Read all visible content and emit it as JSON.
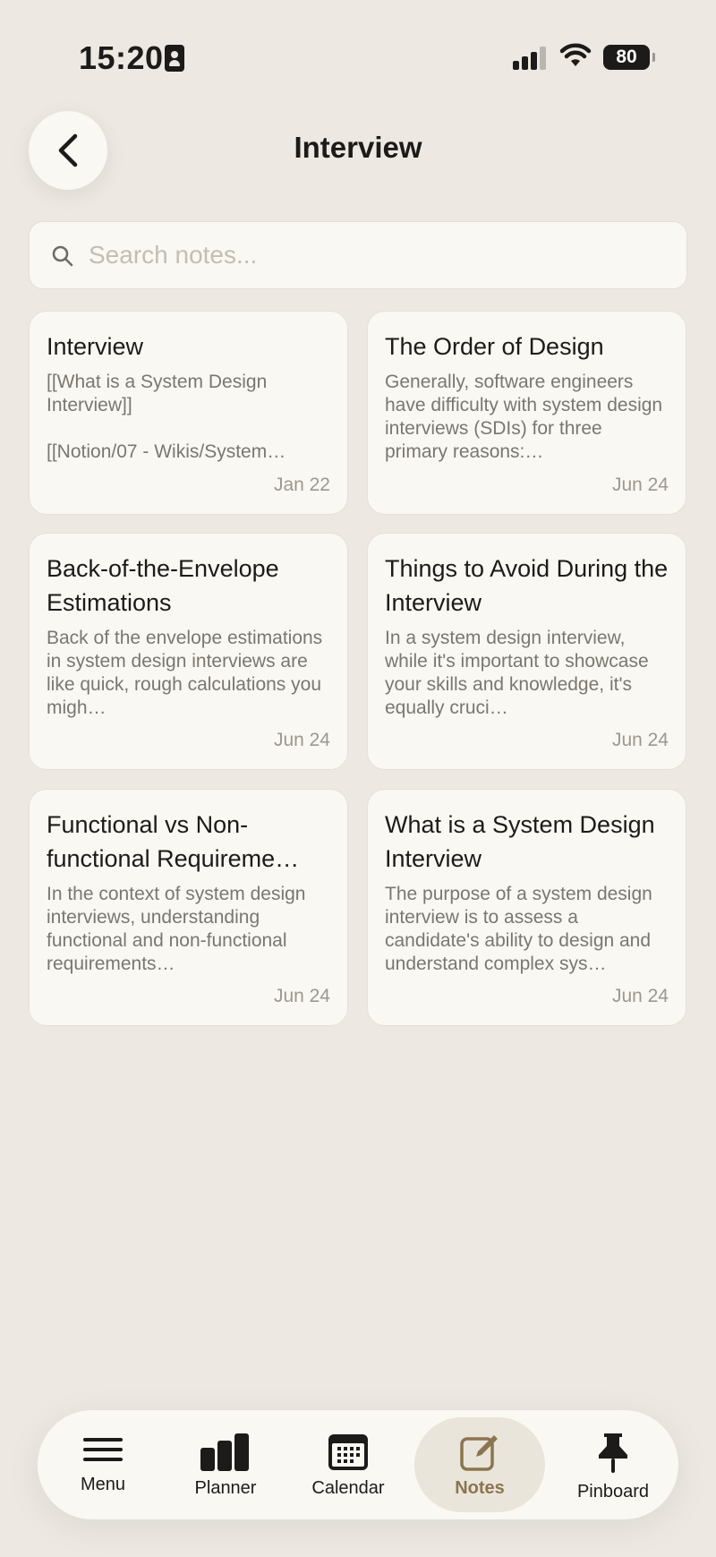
{
  "status_bar": {
    "time": "15:20",
    "battery": "80",
    "icons": [
      "contact-card-icon",
      "signal-icon",
      "wifi-icon",
      "battery-icon"
    ]
  },
  "header": {
    "title": "Interview",
    "back_icon": "chevron-left-icon"
  },
  "search": {
    "placeholder": "Search notes...",
    "value": ""
  },
  "notes": [
    {
      "title": "Interview",
      "snippet": "[[What is a System Design Interview]]\n\n[[Notion/07 - Wikis/System…",
      "date": "Jan 22"
    },
    {
      "title": "The Order of Design",
      "snippet": "Generally, software engineers have difficulty with system design interviews (SDIs) for three primary reasons:…",
      "date": "Jun 24"
    },
    {
      "title": "Back-of-the-Envelope Estimations",
      "snippet": "Back of the envelope estimations in system design interviews are like quick, rough calculations you migh…",
      "date": "Jun 24"
    },
    {
      "title": "Things to Avoid During the Interview",
      "snippet": "In a system design interview, while it's important to showcase your skills and knowledge, it's equally cruci…",
      "date": "Jun 24"
    },
    {
      "title": "Functional vs Non-functional Requireme…",
      "snippet": "In the context of system design interviews, understanding functional and non-functional requirements…",
      "date": "Jun 24"
    },
    {
      "title": "What is a System Design Interview",
      "snippet": "The purpose of a system design interview is to assess a candidate's ability to design and understand complex sys…",
      "date": "Jun 24"
    }
  ],
  "tabbar": {
    "active": "Notes",
    "active_color": "#8a7550",
    "items": [
      {
        "label": "Menu",
        "icon": "menu-icon"
      },
      {
        "label": "Planner",
        "icon": "bar-chart-icon"
      },
      {
        "label": "Calendar",
        "icon": "calendar-icon"
      },
      {
        "label": "Notes",
        "icon": "compose-icon"
      },
      {
        "label": "Pinboard",
        "icon": "pin-icon"
      }
    ]
  }
}
